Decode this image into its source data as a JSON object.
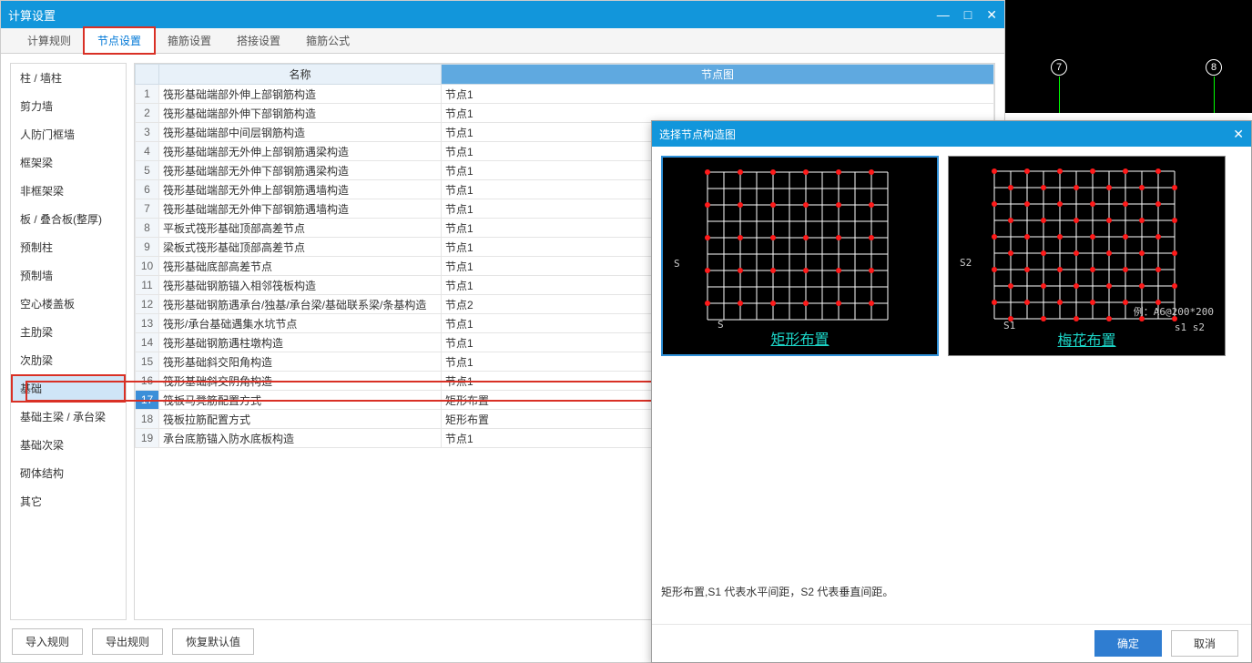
{
  "window": {
    "title": "计算设置",
    "controls": {
      "min": "—",
      "max": "□",
      "close": "✕"
    }
  },
  "tabs": [
    {
      "label": "计算规则",
      "active": false
    },
    {
      "label": "节点设置",
      "active": true,
      "highlight": true
    },
    {
      "label": "箍筋设置",
      "active": false
    },
    {
      "label": "搭接设置",
      "active": false
    },
    {
      "label": "箍筋公式",
      "active": false
    }
  ],
  "sidebar": [
    "柱 / 墙柱",
    "剪力墙",
    "人防门框墙",
    "框架梁",
    "非框架梁",
    "板 / 叠合板(整厚)",
    "预制柱",
    "预制墙",
    "空心楼盖板",
    "主肋梁",
    "次肋梁",
    "基础",
    "基础主梁 / 承台梁",
    "基础次梁",
    "砌体结构",
    "其它"
  ],
  "sidebar_selected": 11,
  "sidebar_highlight": 11,
  "table": {
    "headers": {
      "name": "名称",
      "node": "节点图"
    },
    "rows": [
      {
        "n": 1,
        "name": "筏形基础端部外伸上部钢筋构造",
        "node": "节点1"
      },
      {
        "n": 2,
        "name": "筏形基础端部外伸下部钢筋构造",
        "node": "节点1"
      },
      {
        "n": 3,
        "name": "筏形基础端部中间层钢筋构造",
        "node": "节点1"
      },
      {
        "n": 4,
        "name": "筏形基础端部无外伸上部钢筋遇梁构造",
        "node": "节点1"
      },
      {
        "n": 5,
        "name": "筏形基础端部无外伸下部钢筋遇梁构造",
        "node": "节点1"
      },
      {
        "n": 6,
        "name": "筏形基础端部无外伸上部钢筋遇墙构造",
        "node": "节点1"
      },
      {
        "n": 7,
        "name": "筏形基础端部无外伸下部钢筋遇墙构造",
        "node": "节点1"
      },
      {
        "n": 8,
        "name": "平板式筏形基础顶部高差节点",
        "node": "节点1"
      },
      {
        "n": 9,
        "name": "梁板式筏形基础顶部高差节点",
        "node": "节点1"
      },
      {
        "n": 10,
        "name": "筏形基础底部高差节点",
        "node": "节点1"
      },
      {
        "n": 11,
        "name": "筏形基础钢筋锚入相邻筏板构造",
        "node": "节点1"
      },
      {
        "n": 12,
        "name": "筏形基础钢筋遇承台/独基/承台梁/基础联系梁/条基构造",
        "node": "节点2"
      },
      {
        "n": 13,
        "name": "筏形/承台基础遇集水坑节点",
        "node": "节点1"
      },
      {
        "n": 14,
        "name": "筏形基础钢筋遇柱墩构造",
        "node": "节点1"
      },
      {
        "n": 15,
        "name": "筏形基础斜交阳角构造",
        "node": "节点1"
      },
      {
        "n": 16,
        "name": "筏形基础斜交阴角构造",
        "node": "节点1"
      },
      {
        "n": 17,
        "name": "筏板马凳筋配置方式",
        "node": "矩形布置",
        "selected": true,
        "highlight": true,
        "hasDots": true
      },
      {
        "n": 18,
        "name": "筏板拉筋配置方式",
        "node": "矩形布置"
      },
      {
        "n": 19,
        "name": "承台底筋锚入防水底板构造",
        "node": "节点1"
      }
    ]
  },
  "bottom_buttons": [
    "导入规则",
    "导出规则",
    "恢复默认值"
  ],
  "cad": {
    "num7": "7",
    "num8": "8"
  },
  "dialog": {
    "title": "选择节点构造图",
    "options": [
      {
        "caption": "矩形布置",
        "axisX": "S",
        "axisY": "S",
        "selected": true
      },
      {
        "caption": "梅花布置",
        "axisX": "S1",
        "axisY": "S2",
        "example": "例：A6@200*200",
        "legend": "s1  s2",
        "selected": false
      }
    ],
    "description": "矩形布置,S1 代表水平间距，S2 代表垂直间距。",
    "ok": "确定",
    "cancel": "取消",
    "close": "✕",
    "dots": "⋯"
  }
}
